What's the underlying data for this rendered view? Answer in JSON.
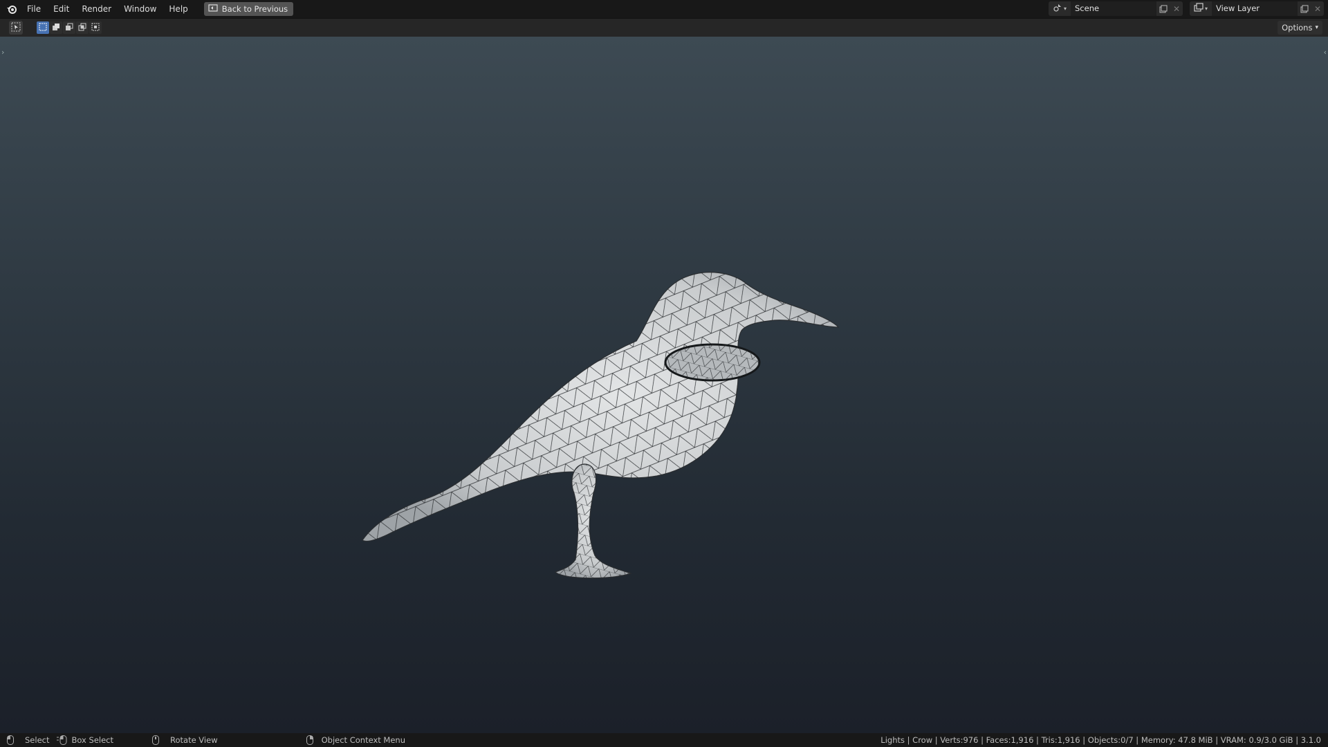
{
  "topbar": {
    "menus": [
      "File",
      "Edit",
      "Render",
      "Window",
      "Help"
    ],
    "back_label": "Back to Previous",
    "scene_name": "Scene",
    "view_layer_name": "View Layer"
  },
  "toolheader": {
    "options_label": "Options"
  },
  "statusbar": {
    "select_label": "Select",
    "box_select_label": "Box Select",
    "rotate_view_label": "Rotate View",
    "context_menu_label": "Object Context Menu",
    "stats": "Lights | Crow | Verts:976 | Faces:1,916 | Tris:1,916 | Objects:0/7 | Memory: 47.8 MiB | VRAM: 0.9/3.0 GiB | 3.1.0"
  },
  "icons": {
    "app_logo": "blender-logo-icon",
    "back": "back-to-previous-icon",
    "scene": "scene-icon",
    "view_layer": "view-layer-icon",
    "select_tool": "select-box-tool-icon"
  },
  "colors": {
    "accent": "#4772b3",
    "viewport_top": "#3d4a53",
    "viewport_bottom": "#1b2029",
    "mesh_fill": "#cfd2d4"
  }
}
